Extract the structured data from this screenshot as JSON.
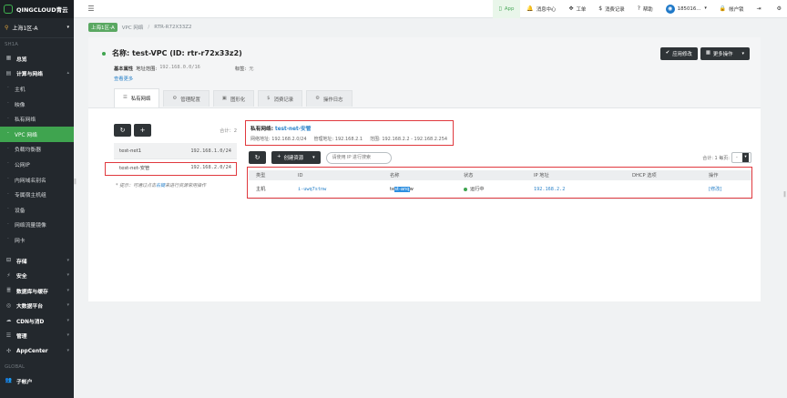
{
  "logo": {
    "text": "QINGCLOUD青云"
  },
  "region": {
    "label": "上海1区-A"
  },
  "sidebar": {
    "section_region": "SH1A",
    "overview": "总览",
    "compute_group": "计算与网络",
    "compute_items": [
      "主机",
      "映像",
      "私有网络",
      "VPC 网络",
      "负载均衡器",
      "公网IP",
      "内网域名别名",
      "专属宿主机组",
      "设备",
      "网络流量镜像",
      "网卡"
    ],
    "groups": [
      "存储",
      "安全",
      "数据库与缓存",
      "大数据平台",
      "CDN与消D",
      "管理",
      "AppCenter"
    ],
    "section_global": "GLOBAL",
    "sub_account": "子帐户"
  },
  "topbar": {
    "app": "App",
    "messages": "消息中心",
    "tickets": "工单",
    "billing": "消费记录",
    "help": "帮助",
    "user": "185016...",
    "account": "帐户锁"
  },
  "breadcrumb": {
    "zone": "上海1区-A",
    "vpc": "VPC 网络",
    "router": "RTR-R72X33Z2"
  },
  "header": {
    "title": "名称: test-VPC (ID: rtr-r72x33z2)",
    "attr_label": "基本属性",
    "addr_label": "地址范围:",
    "addr_value": "192.168.0.0/16",
    "tag_label": "标签:",
    "tag_value": "无",
    "view_more": "查看更多",
    "apply_button": "应用修改",
    "more_button": "更多操作"
  },
  "tabs": [
    {
      "label": "私有网络",
      "icon": "list-icon"
    },
    {
      "label": "管理配置",
      "icon": "settings-icon"
    },
    {
      "label": "图形化",
      "icon": "image-icon"
    },
    {
      "label": "消费记录",
      "icon": "dollar-icon"
    },
    {
      "label": "操作日志",
      "icon": "gear-icon"
    }
  ],
  "net_list": {
    "total": "合计：2",
    "rows": [
      {
        "name": "test-net1",
        "cidr": "192.168.1.0/24"
      },
      {
        "name": "test-net-安管",
        "cidr": "192.168.2.0/24"
      }
    ],
    "tip_prefix": "* 提示：可通过点击",
    "tip_link": "右键",
    "tip_suffix": "来进行资源常用操作"
  },
  "detail": {
    "title_label": "私有网络:",
    "title_value": "test-net-安管",
    "net_addr": "网络地址: 192.168.2.0/24",
    "mgmt_addr": "管理地址: 192.168.2.1",
    "range": "范围: 192.168.2.2 - 192.168.2.254",
    "create_button": "创建资源",
    "search_placeholder": "请使用 IP 进行搜索",
    "total": "合计: 1  每页:",
    "page_size": "-"
  },
  "table": {
    "headers": [
      "类型",
      "ID",
      "名称",
      "状态",
      "IP 地址",
      "DHCP 选项",
      "操作"
    ],
    "rows": [
      {
        "type": "主机",
        "id": "i-uwq7stnw",
        "name_pre": "te",
        "name_sel": "st-anq",
        "name_post": "w",
        "status": "运行中",
        "ip": "192.168.2.2",
        "dhcp": "",
        "action": "[修改]"
      }
    ]
  }
}
